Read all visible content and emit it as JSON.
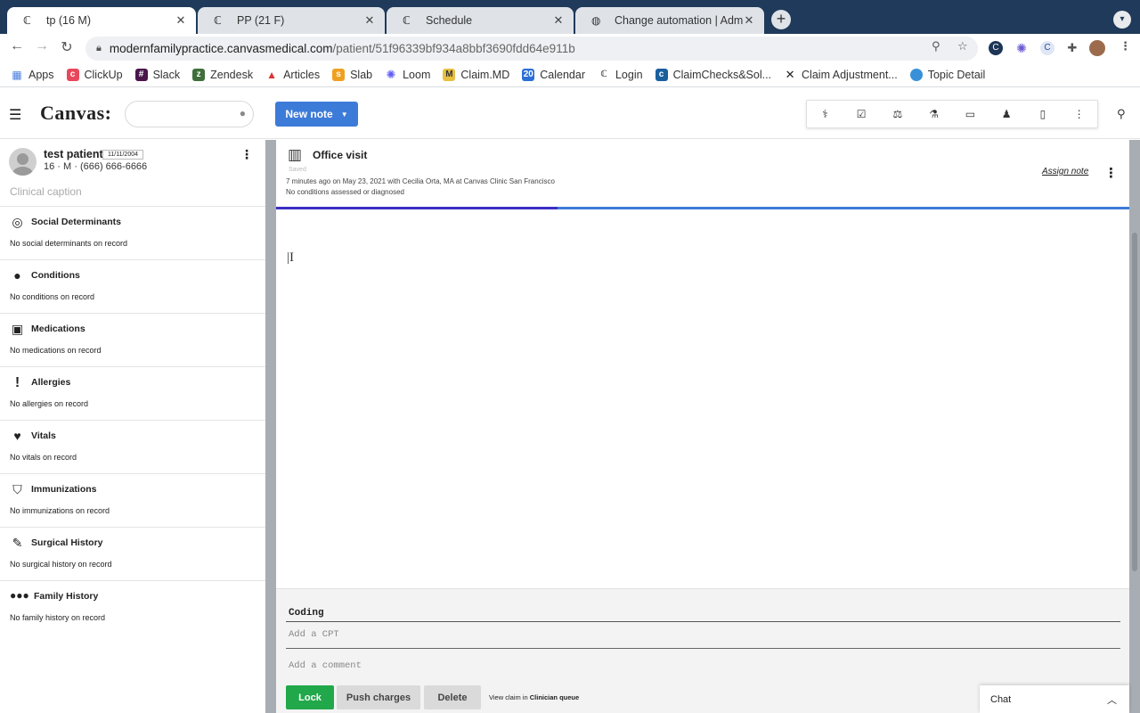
{
  "browser": {
    "tabs": [
      {
        "title": "tp (16 M)",
        "active": true
      },
      {
        "title": "PP (21 F)",
        "active": false
      },
      {
        "title": "Schedule",
        "active": false
      },
      {
        "title": "Change automation | Admin",
        "active": false
      }
    ],
    "url_host": "modernfamilypractice.canvasmedical.com",
    "url_path": "/patient/51f96339bf934a8bbf3690fdd64e911b",
    "bookmarks": [
      "Apps",
      "ClickUp",
      "Slack",
      "Zendesk",
      "Articles",
      "Slab",
      "Loom",
      "Claim.MD",
      "Calendar",
      "Login",
      "ClaimChecks&Sol...",
      "Claim Adjustment...",
      "Topic Detail"
    ]
  },
  "header": {
    "logo": "Canvas:",
    "new_note_label": "New note"
  },
  "patient": {
    "name": "test patient",
    "dob": "11/11/2004",
    "info": "16 · M · (666) 666-6666",
    "caption": "Clinical caption"
  },
  "sidebar": {
    "sections": [
      {
        "title": "Social Determinants",
        "value": "No social determinants on record",
        "icon": "target-icon"
      },
      {
        "title": "Conditions",
        "value": "No conditions on record",
        "icon": "person-icon"
      },
      {
        "title": "Medications",
        "value": "No medications on record",
        "icon": "medkit-icon"
      },
      {
        "title": "Allergies",
        "value": "No allergies on record",
        "icon": "exclamation-icon"
      },
      {
        "title": "Vitals",
        "value": "No vitals on record",
        "icon": "heartbeat-icon"
      },
      {
        "title": "Immunizations",
        "value": "No immunizations on record",
        "icon": "shield-icon"
      },
      {
        "title": "Surgical History",
        "value": "No surgical history on record",
        "icon": "scalpel-icon"
      },
      {
        "title": "Family History",
        "value": "No family history on record",
        "icon": "family-icon"
      }
    ]
  },
  "note": {
    "title": "Office visit",
    "saved": "Saved",
    "meta_line1": "7 minutes ago on May 23, 2021 with Cecilia Orta, MA at Canvas Clinic San Francisco",
    "meta_line2": "No conditions assessed or diagnosed",
    "assign": "Assign note",
    "progress_fraction": 0.33
  },
  "coding": {
    "label": "Coding",
    "cpt_placeholder": "Add a CPT",
    "comment_placeholder": "Add a comment",
    "lock": "Lock",
    "push": "Push charges",
    "delete": "Delete",
    "view_claim_prefix": "View claim in",
    "view_claim_link": "Clinician queue"
  },
  "chat": {
    "label": "Chat"
  },
  "colors": {
    "primary": "#3d7bd8",
    "lock_green": "#21a84a",
    "progress_purple": "#3c2fc4",
    "tabstrip": "#1f3a5a"
  }
}
